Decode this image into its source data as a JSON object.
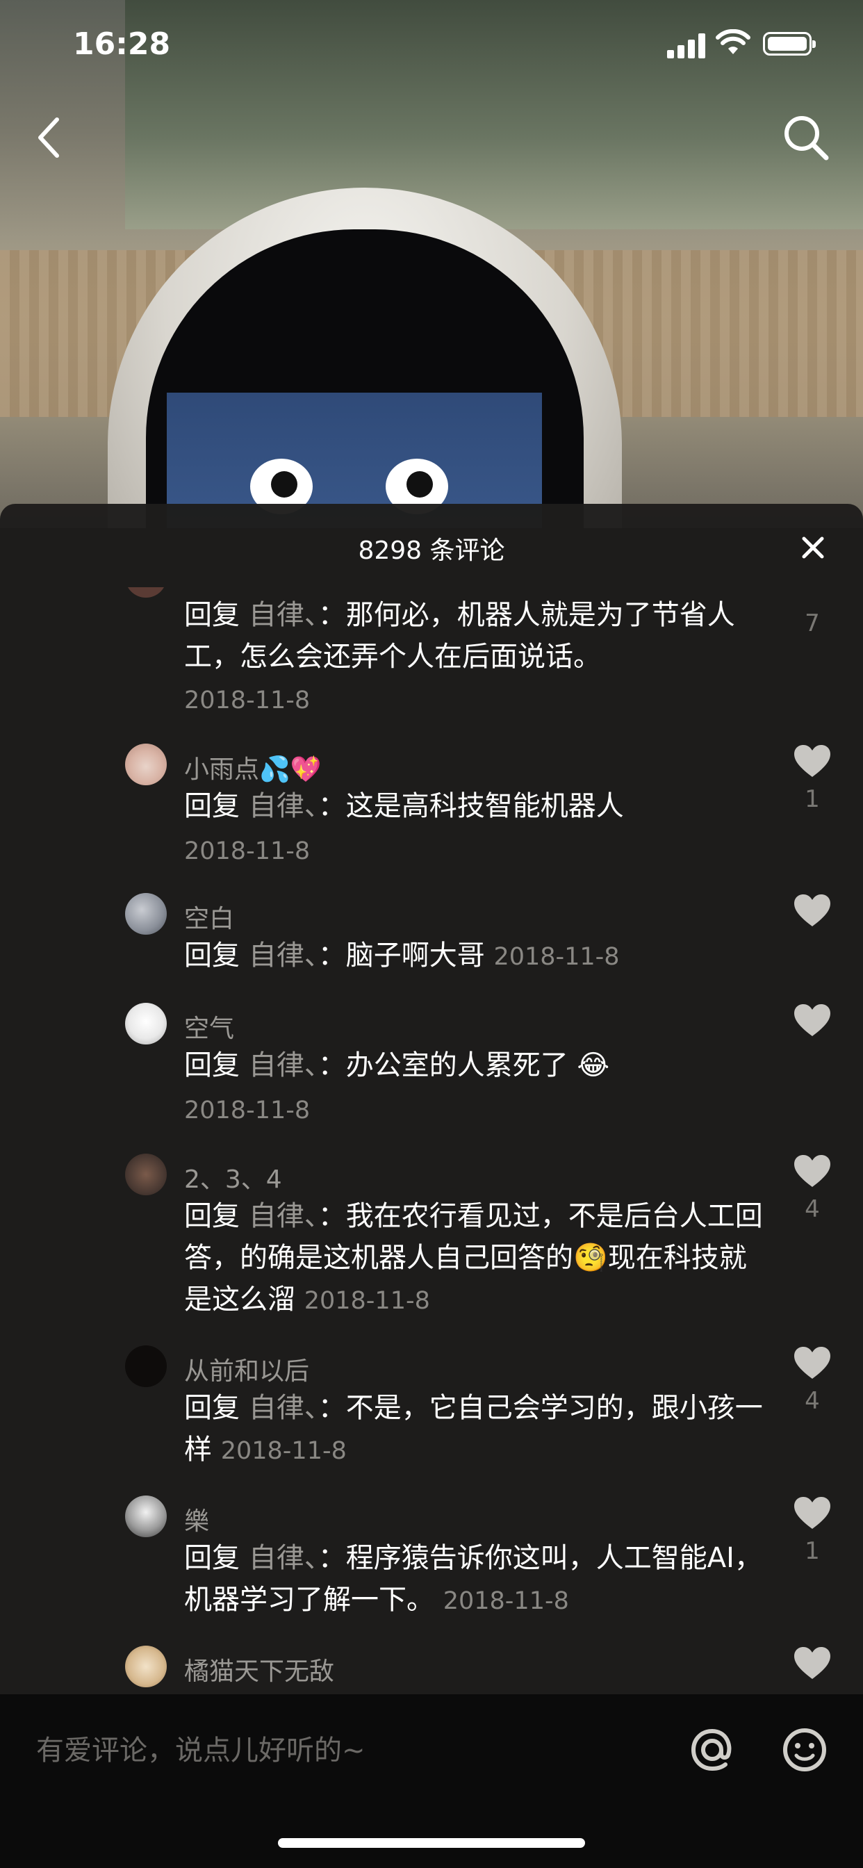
{
  "status_bar": {
    "time": "16:28"
  },
  "nav": {
    "back_icon": "chevron-left-icon",
    "search_icon": "search-icon"
  },
  "sheet": {
    "title": "8298 条评论",
    "close_icon": "close-icon"
  },
  "comments": [
    {
      "username": "",
      "reply_word": "回复",
      "target": "自律、",
      "text": "：那何必，机器人就是为了节省人工，怎么会还弄个人在后面说话。",
      "date": "2018-11-8",
      "likes": "7"
    },
    {
      "username": "小雨点💦💖",
      "reply_word": "回复",
      "target": "自律、",
      "text": "：这是高科技智能机器人",
      "date": "2018-11-8",
      "likes": "1"
    },
    {
      "username": "空白",
      "reply_word": "回复",
      "target": "自律、",
      "text": "：脑子啊大哥",
      "date": "2018-11-8",
      "likes": ""
    },
    {
      "username": "空气",
      "reply_word": "回复",
      "target": "自律、",
      "text": "：办公室的人累死了 😂",
      "date": "2018-11-8",
      "likes": ""
    },
    {
      "username": "2、3、4",
      "reply_word": "回复",
      "target": "自律、",
      "text": "：我在农行看见过，不是后台人工回答，的确是这机器人自己回答的🧐现在科技就是这么溜",
      "date": "2018-11-8",
      "likes": "4"
    },
    {
      "username": "从前和以后",
      "reply_word": "回复",
      "target": "自律、",
      "text": "：不是，它自己会学习的，跟小孩一样",
      "date": "2018-11-8",
      "likes": "4"
    },
    {
      "username": "樂",
      "reply_word": "回复",
      "target": "自律、",
      "text": "：程序猿告诉你这叫，人工智能AI，机器学习了解一下。",
      "date": "2018-11-8",
      "likes": "1"
    },
    {
      "username": "橘猫天下无敌",
      "reply_word": "",
      "target": "",
      "text": "",
      "date": "",
      "likes": ""
    }
  ],
  "input": {
    "placeholder": "有爱评论，说点儿好听的~",
    "at_icon": "at-icon",
    "emoji_icon": "emoji-icon"
  },
  "colors": {
    "sheet_bg": "#1e1d1c",
    "muted_text": "#9a9894",
    "heart": "#c8c6c2"
  }
}
